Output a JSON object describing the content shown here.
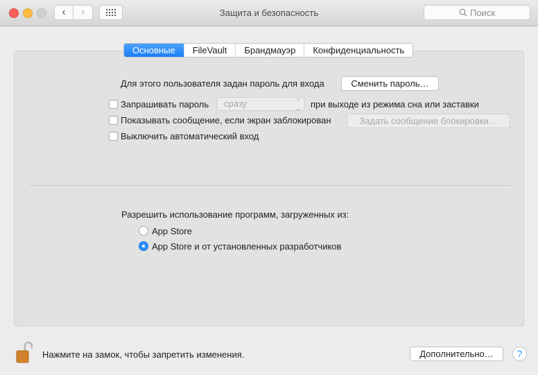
{
  "window": {
    "title": "Защита и безопасность",
    "search_placeholder": "Поиск",
    "back_icon": "‹",
    "forward_icon": "›"
  },
  "tabs": [
    {
      "label": "Основные",
      "active": true
    },
    {
      "label": "FileVault",
      "active": false
    },
    {
      "label": "Брандмауэр",
      "active": false
    },
    {
      "label": "Конфиденциальность",
      "active": false
    }
  ],
  "general": {
    "password_text": "Для этого пользователя задан пароль для входа",
    "change_password_button": "Сменить пароль…",
    "require_password": {
      "label": "Запрашивать пароль",
      "checked": false,
      "select_value": "сразу",
      "suffix": "при выходе из режима сна или заставки"
    },
    "show_message": {
      "label": "Показывать сообщение, если экран заблокирован",
      "checked": false,
      "button": "Задать сообщение блокировки…"
    },
    "disable_autologin": {
      "label": "Выключить автоматический вход",
      "checked": false
    }
  },
  "downloads": {
    "heading": "Разрешить использование программ, загруженных из:",
    "options": [
      {
        "label": "App Store",
        "selected": false
      },
      {
        "label": "App Store и от установленных разработчиков",
        "selected": true
      }
    ]
  },
  "footer": {
    "lock_text": "Нажмите на замок, чтобы запретить изменения.",
    "advanced_button": "Дополнительно…",
    "help_label": "?"
  },
  "colors": {
    "accent": "#2f8ff7",
    "close": "#fc605c",
    "minimize": "#fdbc40"
  }
}
